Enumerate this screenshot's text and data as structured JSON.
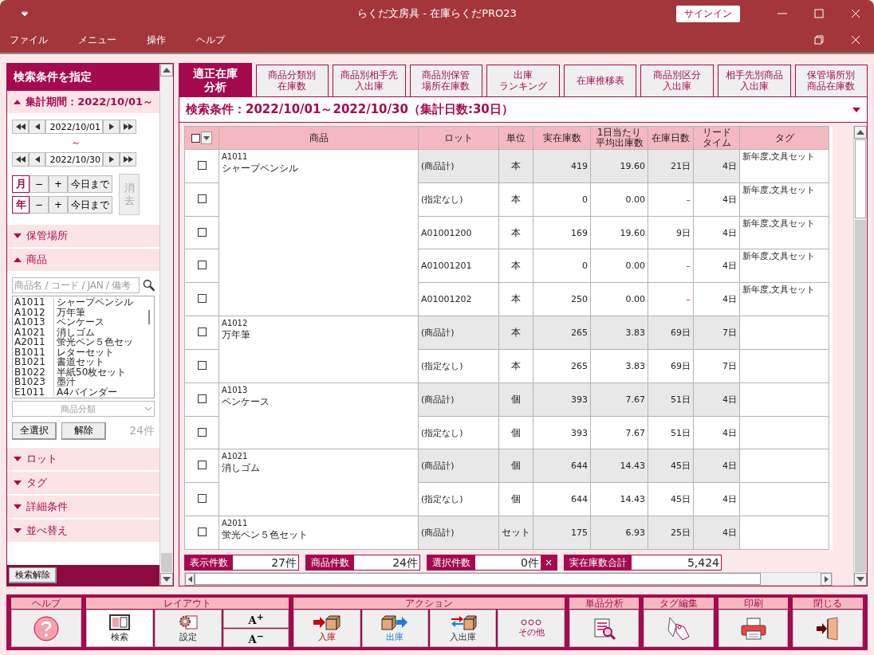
{
  "window": {
    "title": "らくだ文房具  -  在庫らくだPRO23",
    "signin": "サインイン"
  },
  "menu": [
    "ファイル",
    "メニュー",
    "操作",
    "ヘルプ"
  ],
  "sidebar": {
    "title": "検索条件を指定",
    "period": {
      "label": "集計期間：2022/10/01～",
      "expanded": true,
      "from": "2022/10/01",
      "sep": "～",
      "to": "2022/10/30",
      "units": [
        {
          "label": "月",
          "minus": "−",
          "plus": "+",
          "today": "今日まで"
        },
        {
          "label": "年",
          "minus": "−",
          "plus": "+",
          "today": "今日まで"
        }
      ],
      "clear": "消去",
      "clear_disabled": true
    },
    "sections_before": [
      {
        "label": "保管場所",
        "expanded": false
      }
    ],
    "products": {
      "label": "商品",
      "expanded": true,
      "placeholder": "商品名 / コード / JAN / 備考",
      "items": [
        {
          "code": "A1011",
          "name": "シャープペンシル"
        },
        {
          "code": "A1012",
          "name": "万年筆"
        },
        {
          "code": "A1013",
          "name": "ペンケース"
        },
        {
          "code": "A1021",
          "name": "消しゴム"
        },
        {
          "code": "A2011",
          "name": "蛍光ペン５色セッ"
        },
        {
          "code": "B1011",
          "name": "レターセット"
        },
        {
          "code": "B1021",
          "name": "書道セット"
        },
        {
          "code": "B1022",
          "name": "半紙50枚セット"
        },
        {
          "code": "B1023",
          "name": "墨汁"
        },
        {
          "code": "E1011",
          "name": "A4バインダー"
        }
      ],
      "category_placeholder": "商品分類",
      "select_all": "全選択",
      "deselect": "解除",
      "count": "24件"
    },
    "sections_after": [
      {
        "label": "ロット",
        "expanded": false
      },
      {
        "label": "タグ",
        "expanded": false
      },
      {
        "label": "詳細条件",
        "expanded": false
      },
      {
        "label": "並べ替え",
        "expanded": false
      }
    ],
    "reset": "検索解除"
  },
  "tabs": [
    {
      "lines": [
        "適正在庫",
        "分析"
      ],
      "selected": true
    },
    {
      "lines": [
        "商品分類別",
        "在庫数"
      ],
      "selected": false
    },
    {
      "lines": [
        "商品別相手先",
        "入出庫"
      ],
      "selected": false
    },
    {
      "lines": [
        "商品別保管",
        "場所在庫数"
      ],
      "selected": false
    },
    {
      "lines": [
        "出庫",
        "ランキング"
      ],
      "selected": false
    },
    {
      "lines": [
        "在庫推移表"
      ],
      "selected": false
    },
    {
      "lines": [
        "商品別区分",
        "入出庫"
      ],
      "selected": false
    },
    {
      "lines": [
        "相手先別商品",
        "入出庫"
      ],
      "selected": false
    },
    {
      "lines": [
        "保管場所別",
        "商品在庫数"
      ],
      "selected": false
    }
  ],
  "condition": "検索条件：2022/10/01～2022/10/30（集計日数:30日）",
  "table": {
    "header_checked": false,
    "columns": [
      [
        "商品"
      ],
      [
        "ロット"
      ],
      [
        "単位"
      ],
      [
        "実在庫数"
      ],
      [
        "1日当たり",
        "平均出庫数"
      ],
      [
        "在庫日数"
      ],
      [
        "リード",
        "タイム"
      ],
      [
        "タグ"
      ]
    ],
    "products": [
      {
        "code": "A1011",
        "name": "シャープペンシル",
        "rows": [
          {
            "kind": "total",
            "checked": false,
            "lot": "(商品計)",
            "unit": "本",
            "stock": "419",
            "avg": "19.60",
            "days": "21日",
            "lead": "4日",
            "tag": "新年度,文具セット"
          },
          {
            "kind": "lot",
            "checked": false,
            "lot": "(指定なし)",
            "unit": "本",
            "stock": "0",
            "avg": "0.00",
            "days": "–",
            "lead": "4日",
            "tag": "新年度,文具セット"
          },
          {
            "kind": "lot",
            "checked": false,
            "lot": "A01001200",
            "unit": "本",
            "stock": "169",
            "avg": "19.60",
            "days": "9日",
            "lead": "4日",
            "tag": "新年度,文具セット"
          },
          {
            "kind": "lot",
            "checked": false,
            "lot": "A01001201",
            "unit": "本",
            "stock": "0",
            "avg": "0.00",
            "days": "–",
            "lead": "4日",
            "tag": "新年度,文具セット"
          },
          {
            "kind": "lot",
            "checked": false,
            "lot": "A01001202",
            "unit": "本",
            "stock": "250",
            "avg": "0.00",
            "days": "–",
            "lead": "4日",
            "tag": "新年度,文具セット"
          }
        ]
      },
      {
        "code": "A1012",
        "name": "万年筆",
        "rows": [
          {
            "kind": "total",
            "checked": false,
            "lot": "(商品計)",
            "unit": "本",
            "stock": "265",
            "avg": "3.83",
            "days": "69日",
            "lead": "7日"
          },
          {
            "kind": "lot",
            "checked": false,
            "lot": "(指定なし)",
            "unit": "本",
            "stock": "265",
            "avg": "3.83",
            "days": "69日",
            "lead": "7日"
          }
        ]
      },
      {
        "code": "A1013",
        "name": "ペンケース",
        "rows": [
          {
            "kind": "total",
            "checked": false,
            "lot": "(商品計)",
            "unit": "個",
            "stock": "393",
            "avg": "7.67",
            "days": "51日",
            "lead": "4日"
          },
          {
            "kind": "lot",
            "checked": false,
            "lot": "(指定なし)",
            "unit": "個",
            "stock": "393",
            "avg": "7.67",
            "days": "51日",
            "lead": "4日"
          }
        ]
      },
      {
        "code": "A1021",
        "name": "消しゴム",
        "rows": [
          {
            "kind": "total",
            "checked": false,
            "lot": "(商品計)",
            "unit": "個",
            "stock": "644",
            "avg": "14.43",
            "days": "45日",
            "lead": "4日"
          },
          {
            "kind": "lot",
            "checked": false,
            "lot": "(指定なし)",
            "unit": "個",
            "stock": "644",
            "avg": "14.43",
            "days": "45日",
            "lead": "4日"
          }
        ]
      },
      {
        "code": "A2011",
        "name": "蛍光ペン５色セット",
        "rows": [
          {
            "kind": "total",
            "checked": false,
            "lot": "(商品計)",
            "unit": "セット",
            "stock": "175",
            "avg": "6.93",
            "days": "25日",
            "lead": "4日"
          }
        ]
      }
    ]
  },
  "status": [
    {
      "label": "表示件数",
      "value": "27件"
    },
    {
      "label": "商品件数",
      "value": "24件"
    },
    {
      "label": "選択件数",
      "value": "0件",
      "clear": "×"
    },
    {
      "label": "実在庫数合計",
      "value": "5,424"
    }
  ],
  "toolbar": [
    {
      "title": "ヘルプ",
      "buttons": [
        {
          "kind": "help",
          "selected": false
        }
      ]
    },
    {
      "title": "レイアウト",
      "buttons": [
        {
          "kind": "search",
          "label": "検索",
          "selected": true
        },
        {
          "kind": "settings",
          "label": "設定",
          "selected": false
        },
        {
          "kind": "font",
          "up": "A$^{+}$",
          "down": "A$^{−}$"
        }
      ]
    },
    {
      "title": "アクション",
      "buttons": [
        {
          "kind": "in",
          "label": "入庫",
          "selected": false
        },
        {
          "kind": "out",
          "label": "出庫",
          "selected": false
        },
        {
          "kind": "inout",
          "label": "入出庫",
          "selected": false
        },
        {
          "kind": "more",
          "label": "その他",
          "selected": false
        }
      ]
    },
    {
      "title": "単品分析",
      "buttons": [
        {
          "kind": "analysis",
          "selected": false
        }
      ]
    },
    {
      "title": "タグ編集",
      "buttons": [
        {
          "kind": "tag",
          "selected": false
        }
      ]
    },
    {
      "title": "印刷",
      "buttons": [
        {
          "kind": "print",
          "selected": false
        }
      ]
    },
    {
      "title": "閉じる",
      "buttons": [
        {
          "kind": "close",
          "selected": false
        }
      ]
    }
  ]
}
